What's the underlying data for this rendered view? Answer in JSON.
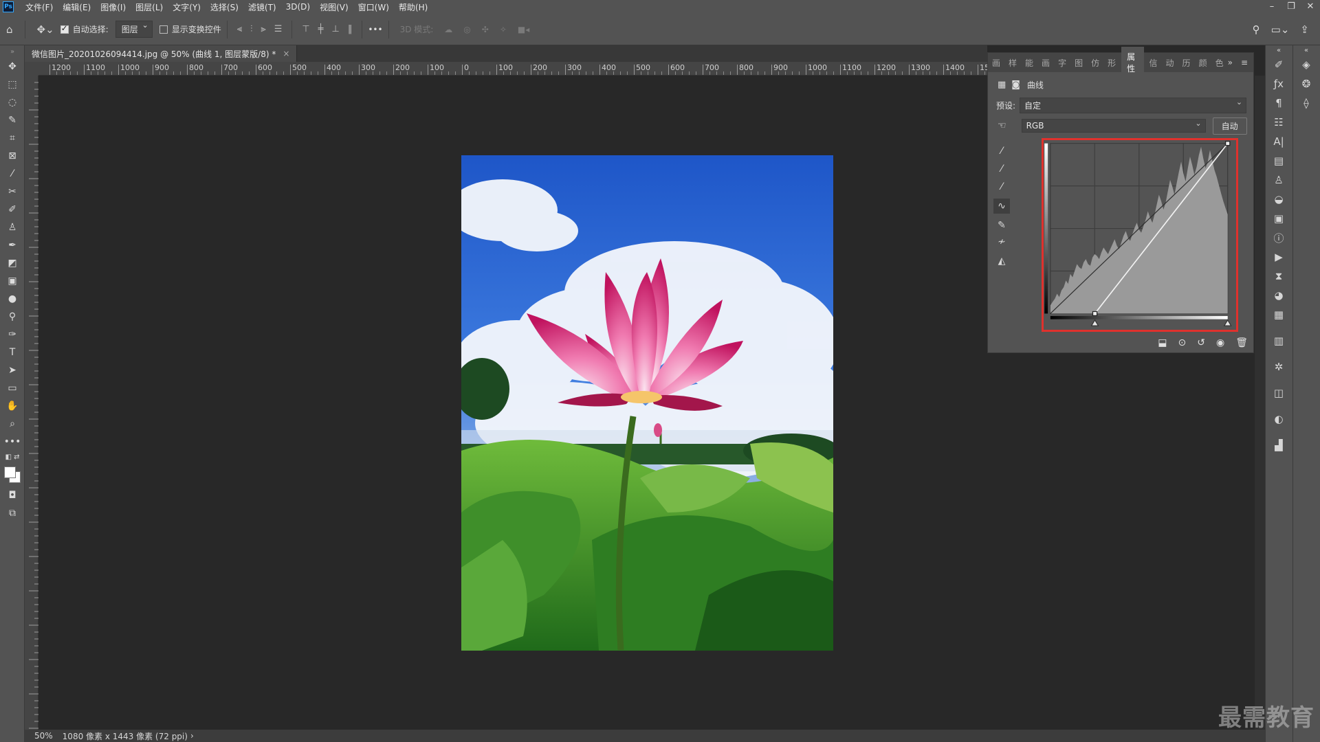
{
  "app": {
    "logo": "Ps"
  },
  "menu": [
    "文件(F)",
    "编辑(E)",
    "图像(I)",
    "图层(L)",
    "文字(Y)",
    "选择(S)",
    "滤镜(T)",
    "3D(D)",
    "视图(V)",
    "窗口(W)",
    "帮助(H)"
  ],
  "window_controls": {
    "minimize": "–",
    "restore": "❐",
    "close": "✕"
  },
  "options": {
    "auto_select_label": "自动选择:",
    "auto_select_checked": true,
    "auto_select_target": "图层",
    "show_transform_label": "显示变换控件",
    "show_transform_checked": false,
    "more": "•••",
    "mode_3d_label": "3D 模式:"
  },
  "document": {
    "tab_title": "微信图片_20201026094414.jpg @ 50% (曲线 1, 图层蒙版/8) *",
    "tab_close": "×"
  },
  "ruler_h_labels": [
    "1200",
    "1100",
    "1000",
    "900",
    "800",
    "700",
    "600",
    "500",
    "400",
    "300",
    "200",
    "100",
    "0",
    "100",
    "200",
    "300",
    "400",
    "500",
    "600",
    "700",
    "800",
    "900",
    "1000",
    "1100",
    "1200",
    "1300",
    "1400",
    "15"
  ],
  "status": {
    "zoom": "50%",
    "info": "1080 像素 x 1443 像素 (72 ppi)",
    "arrow": "›"
  },
  "properties": {
    "tabs": [
      "画",
      "样",
      "能",
      "画",
      "字",
      "图",
      "仿",
      "形",
      "属性",
      "信",
      "动",
      "历",
      "颜",
      "色"
    ],
    "active_tab": "属性",
    "panel_menu": "≡",
    "expand": "»",
    "title": "曲线",
    "preset_label": "预设:",
    "preset_value": "自定",
    "channel_value": "RGB",
    "auto_button": "自动"
  },
  "curve": {
    "input_range": [
      0,
      255
    ],
    "output_range": [
      0,
      255
    ],
    "points": [
      [
        0,
        0
      ],
      [
        255,
        255
      ]
    ],
    "black_input": 64,
    "histogram": [
      5,
      7,
      9,
      12,
      10,
      14,
      16,
      20,
      18,
      24,
      22,
      26,
      30,
      28,
      27,
      31,
      33,
      30,
      29,
      34,
      36,
      35,
      33,
      37,
      40,
      38,
      36,
      39,
      42,
      45,
      41,
      39,
      43,
      47,
      50,
      46,
      44,
      48,
      52,
      55,
      51,
      49,
      53,
      57,
      62,
      58,
      55,
      60,
      66,
      72,
      68,
      63,
      67,
      74,
      81,
      77,
      72,
      79,
      86,
      92,
      85,
      80,
      88,
      95,
      90,
      84,
      89,
      96,
      101,
      94,
      88,
      92,
      99,
      93,
      87,
      83,
      78,
      73,
      68,
      64,
      60
    ]
  },
  "watermark": "最需教育"
}
